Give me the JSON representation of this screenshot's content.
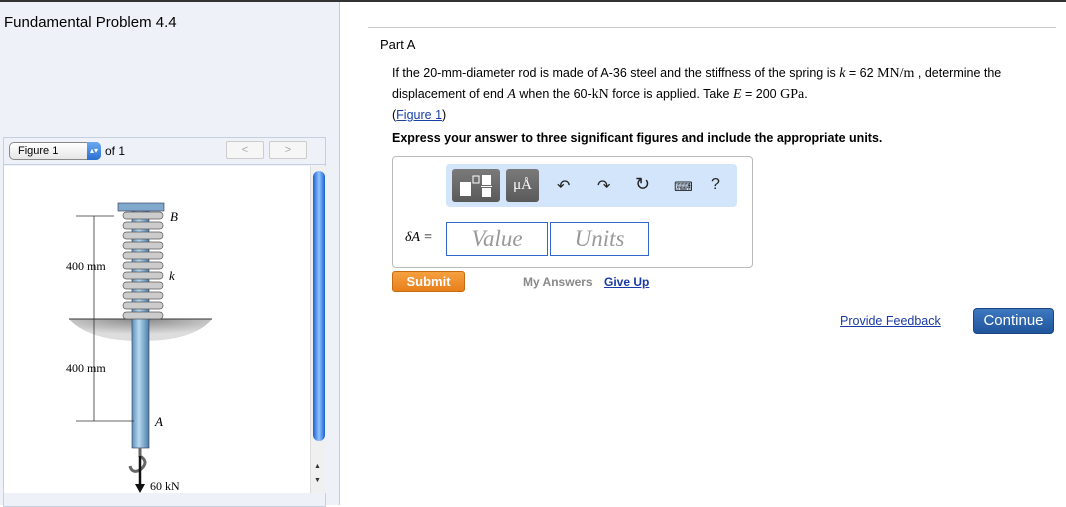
{
  "problem_title": "Fundamental Problem 4.4",
  "figure": {
    "selector": "Figure 1",
    "of_label": "of 1",
    "prev": "<",
    "next": ">",
    "labels": {
      "b": "B",
      "k": "k",
      "a": "A",
      "dim1": "400 mm",
      "dim2": "400 mm",
      "force": "60 kN"
    }
  },
  "part": "Part A",
  "question": {
    "t1": "If the 20-mm-diameter rod is made of A-36 steel and the stiffness of the spring is ",
    "k": "k",
    "t2": " = 62 ",
    "u1": "MN/m",
    "t3": " , determine the displacement of end ",
    "A": "A",
    "t4": " when the 60-",
    "kN": "kN",
    "t5": " force is applied. Take ",
    "E": "E",
    "t6": " = 200 ",
    "GPa": "GPa",
    "t7": ".",
    "figlink": "Figure 1"
  },
  "instruction": "Express your answer to three significant figures and include the appropriate units.",
  "answer": {
    "toolbar": {
      "units_btn": "μÅ",
      "help": "?"
    },
    "label": "δA =",
    "value_placeholder": "Value",
    "units_placeholder": "Units"
  },
  "submit": "Submit",
  "my_answers": "My Answers",
  "give_up": "Give Up",
  "provide_feedback": "Provide Feedback",
  "continue": "Continue"
}
